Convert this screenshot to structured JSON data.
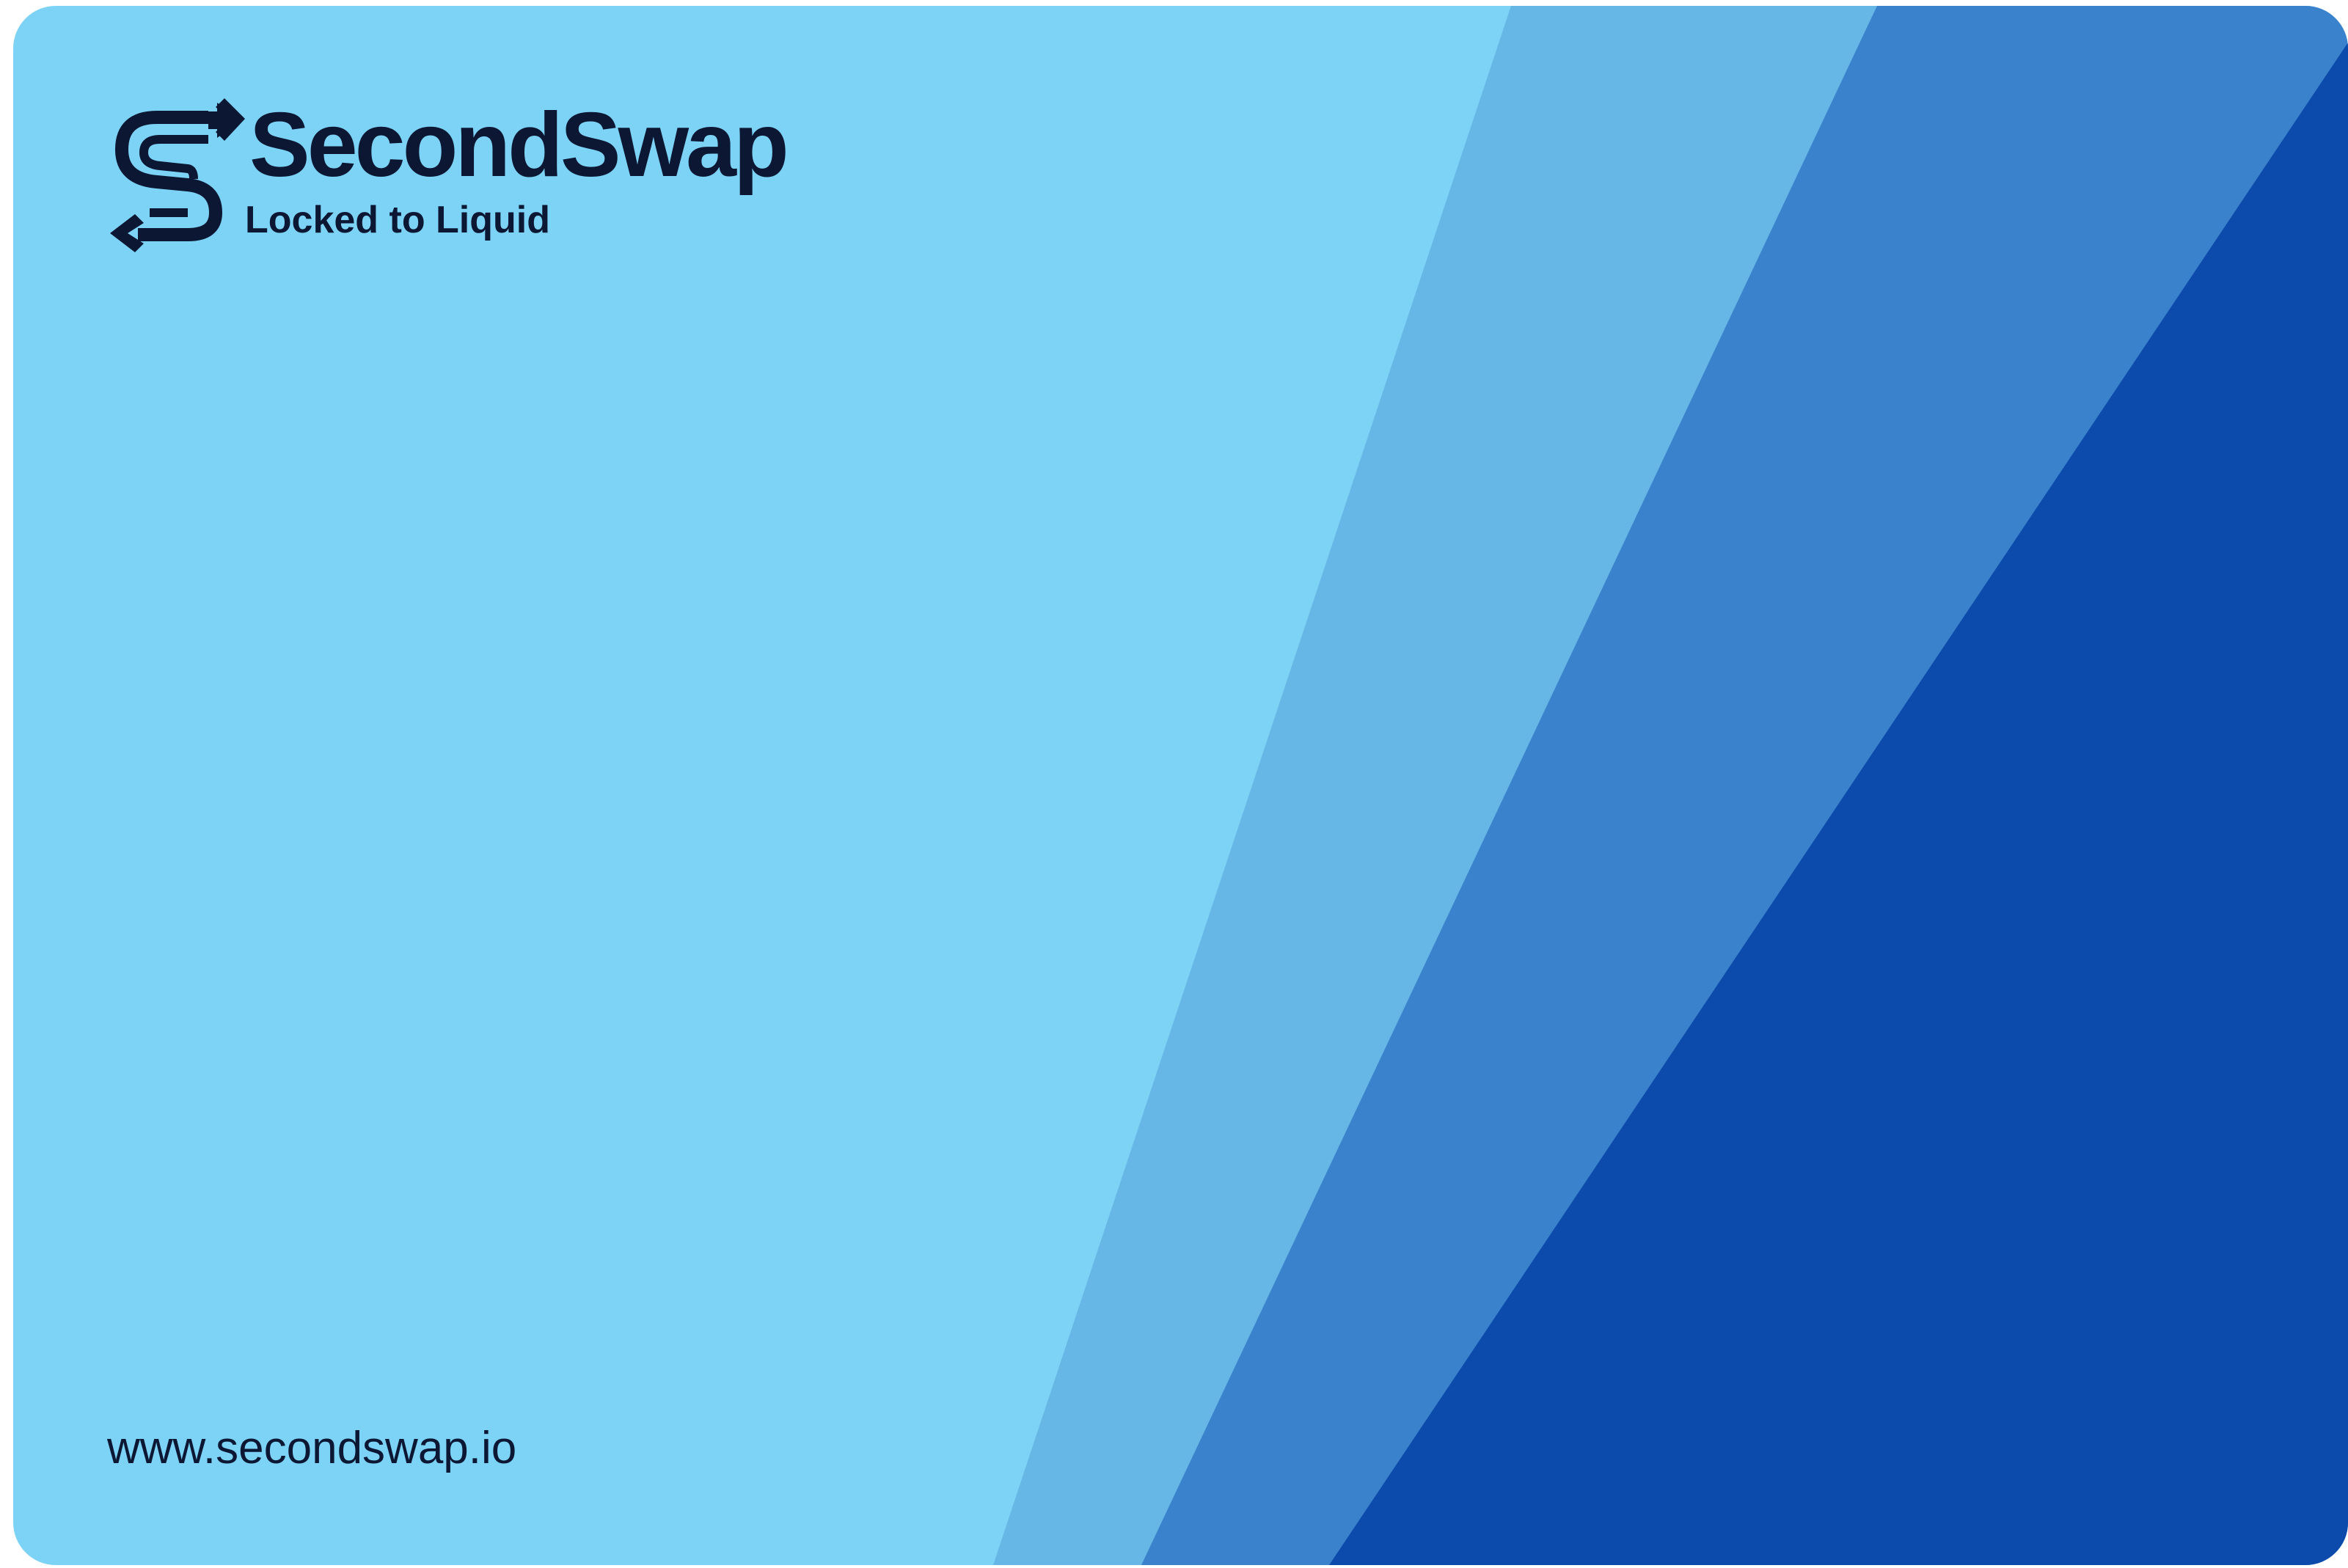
{
  "brand": {
    "name": "SecondSwap",
    "tagline": "Locked to Liquid",
    "logo_icon": "s-swap-arrows-icon"
  },
  "footer": {
    "website": "www.secondswap.io"
  },
  "colors": {
    "base": "#7dd3f5",
    "band_light": "#66b6e6",
    "band_mid": "#3a82cc",
    "band_dark": "#0c4aab",
    "text": "#0b1733"
  }
}
